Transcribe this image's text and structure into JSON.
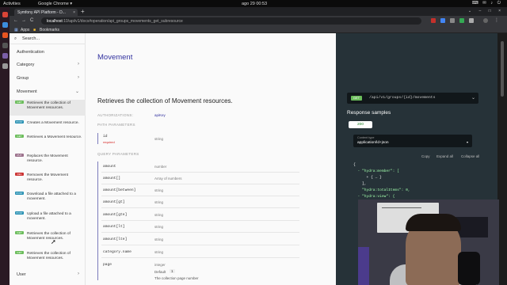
{
  "topbar": {
    "activities": "Activities",
    "app": "Google Chrome ▾",
    "clock": "ago 29  00:53",
    "status_icons": "⌨ ✉ ♪ ⏻"
  },
  "browser": {
    "tab_title": "Symfony API Platform - D...",
    "tab_close": "×",
    "new_tab": "+",
    "window_controls": "⌄ – □ ×",
    "back": "←",
    "forward": "→",
    "reload": "C",
    "url_host": "localhost",
    "url_rest": ":10/api/v1/docs#operation/api_groups_movements_get_subresource",
    "bookmarks": {
      "apps": "Apps",
      "bookmarks": "Bookmarks"
    }
  },
  "sidebar": {
    "search_placeholder": "Search...",
    "items": [
      {
        "label": "Authentication",
        "chev": ""
      },
      {
        "label": "Category",
        "chev": "›"
      },
      {
        "label": "Group",
        "chev": "›"
      },
      {
        "label": "Movement",
        "chev": "⌄"
      }
    ],
    "subitems": [
      {
        "method": "GET",
        "color": "#6bbd5b",
        "label": "Retrieves the collection of Movement resources.",
        "active": true
      },
      {
        "method": "POST",
        "color": "#248fb2",
        "label": "Creates a Movement resource.",
        "active": false
      },
      {
        "method": "GET",
        "color": "#6bbd5b",
        "label": "Retrieves a Movement resource.",
        "active": false
      },
      {
        "method": "PUT",
        "color": "#9b708b",
        "label": "Replaces the Movement resource.",
        "active": false
      },
      {
        "method": "DEL",
        "color": "#cc3333",
        "label": "Removes the Movement resource.",
        "active": false
      },
      {
        "method": "POST",
        "color": "#248fb2",
        "label": "Download a file attached to a movement.",
        "active": false
      },
      {
        "method": "POST",
        "color": "#248fb2",
        "label": "Upload a file attached to a movement.",
        "active": false
      },
      {
        "method": "GET",
        "color": "#6bbd5b",
        "label": "Retrieves the collection of Movement resources.",
        "active": false
      },
      {
        "method": "GET",
        "color": "#6bbd5b",
        "label": "Retrieves the collection of Movement resources.",
        "active": false
      }
    ],
    "user": {
      "label": "User",
      "chev": "›"
    }
  },
  "main": {
    "section_title": "Movement",
    "operation_title": "Retrieves the collection of Movement resources.",
    "authorizations_label": "AUTHORIZATIONS:",
    "authorizations_value": "apiKey",
    "path_params_label": "PATH PARAMETERS",
    "query_params_label": "QUERY PARAMETERS",
    "path_params": [
      {
        "name": "id",
        "required": "required",
        "type": "string"
      }
    ],
    "query_params": [
      {
        "name": "amount",
        "type": "number"
      },
      {
        "name": "amount[]",
        "type": "Array of numbers"
      },
      {
        "name": "amount[between]",
        "type": "string"
      },
      {
        "name": "amount[gt]",
        "type": "string"
      },
      {
        "name": "amount[gte]",
        "type": "string"
      },
      {
        "name": "amount[lt]",
        "type": "string"
      },
      {
        "name": "amount[lte]",
        "type": "string"
      },
      {
        "name": "category.name",
        "type": "string"
      },
      {
        "name": "page",
        "type": "integer"
      }
    ],
    "page_default_label": "Default",
    "page_default_value": "1",
    "page_description": "The collection page number"
  },
  "right": {
    "method": "GET",
    "endpoint": "/api/v1/groups/{id}/movements",
    "endpoint_chev": "⌄",
    "response_samples": "Response samples",
    "status_code": "200",
    "content_type_label": "Content type",
    "content_type_value": "application/ld+json",
    "content_type_caret": "▾",
    "actions": [
      "Copy",
      "Expand all",
      "Collapse all"
    ],
    "code": [
      "{",
      "  - \"hydra:member\": [",
      "      + { … }",
      "    ],",
      "    \"hydra:totalItems\": 0,",
      "  - \"hydra:view\": {"
    ]
  },
  "colors": {
    "accent": "#32329f",
    "get": "#6bbd5b",
    "post": "#248fb2",
    "right_panel": "#263238"
  }
}
